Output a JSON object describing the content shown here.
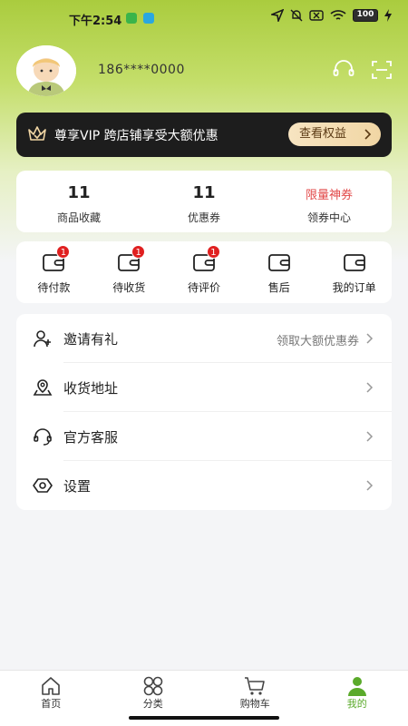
{
  "status_bar": {
    "time": "下午2:54",
    "battery": "100"
  },
  "profile": {
    "phone": "186****0000",
    "icons": [
      "customer-service-headset-icon",
      "scan-icon"
    ]
  },
  "vip_banner": {
    "text": "尊享VIP 跨店铺享受大额优惠",
    "button_label": "查看权益"
  },
  "stats": [
    {
      "value": "11",
      "label": "商品收藏"
    },
    {
      "value": "11",
      "label": "优惠券"
    },
    {
      "promo": "限量神券",
      "label": "领券中心"
    }
  ],
  "orders": [
    {
      "label": "待付款",
      "badge": "1",
      "icon": "wallet-icon"
    },
    {
      "label": "待收货",
      "badge": "1",
      "icon": "wallet-icon"
    },
    {
      "label": "待评价",
      "badge": "1",
      "icon": "wallet-icon"
    },
    {
      "label": "售后",
      "badge": "",
      "icon": "wallet-icon"
    },
    {
      "label": "我的订单",
      "badge": "",
      "icon": "wallet-icon"
    }
  ],
  "menu": [
    {
      "label": "邀请有礼",
      "value": "领取大额优惠券",
      "icon": "add-user-icon"
    },
    {
      "label": "收货地址",
      "value": "",
      "icon": "location-icon"
    },
    {
      "label": "官方客服",
      "value": "",
      "icon": "headset-icon"
    },
    {
      "label": "设置",
      "value": "",
      "icon": "settings-icon"
    }
  ],
  "tabbar": [
    {
      "label": "首页",
      "icon": "home-icon"
    },
    {
      "label": "分类",
      "icon": "category-icon"
    },
    {
      "label": "购物车",
      "icon": "cart-icon"
    },
    {
      "label": "我的",
      "icon": "user-icon",
      "active": true
    }
  ],
  "colors": {
    "accent": "#5aaa2a",
    "header_green": "#aacc3e",
    "promo_red": "#e24a4a",
    "badge_red": "#e02020",
    "vip_bg": "#1d1d1d",
    "vip_button": "#f1d6a4"
  }
}
